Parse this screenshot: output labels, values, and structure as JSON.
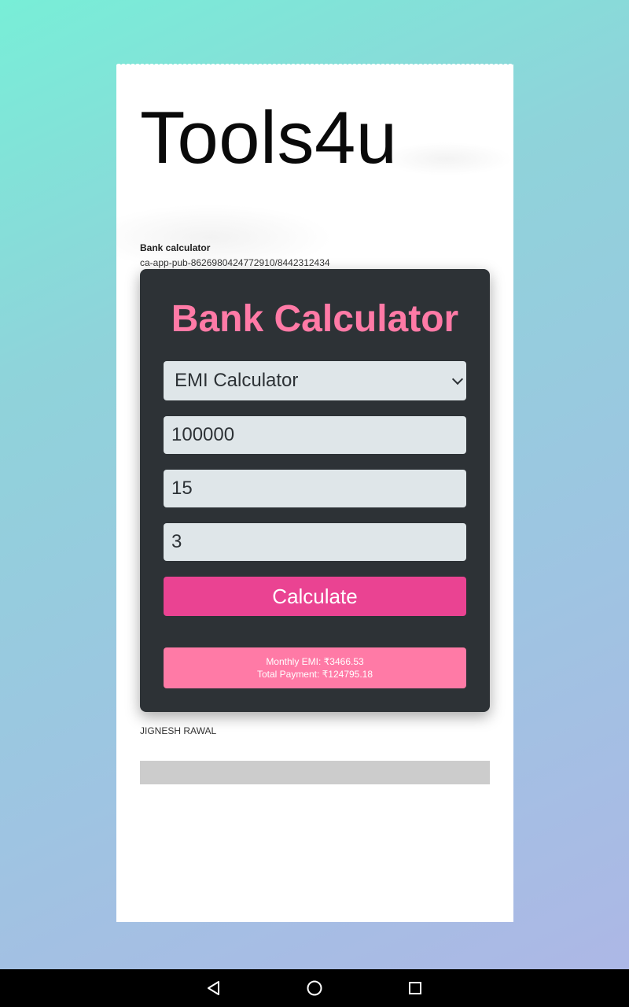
{
  "header": {
    "site_title": "Tools4u"
  },
  "ad": {
    "label": "Bank calculator",
    "unit_id": "ca-app-pub-8626980424772910/8442312434"
  },
  "calculator": {
    "title": "Bank Calculator",
    "mode_select": {
      "selected": "EMI Calculator"
    },
    "inputs": {
      "principal": "100000",
      "rate": "15",
      "tenure": "3"
    },
    "calculate_label": "Calculate",
    "result": {
      "monthly_emi": "Monthly EMI: ₹3466.53",
      "total_payment": "Total Payment: ₹124795.18"
    }
  },
  "footer": {
    "author": "JIGNESH RAWAL"
  },
  "colors": {
    "card_bg": "#2d3236",
    "accent_pink": "#ff7aa6",
    "button_pink": "#ea4392",
    "field_bg": "#dfe6e9"
  },
  "navbar": {
    "icons": [
      "back-icon",
      "home-icon",
      "recents-icon"
    ]
  }
}
